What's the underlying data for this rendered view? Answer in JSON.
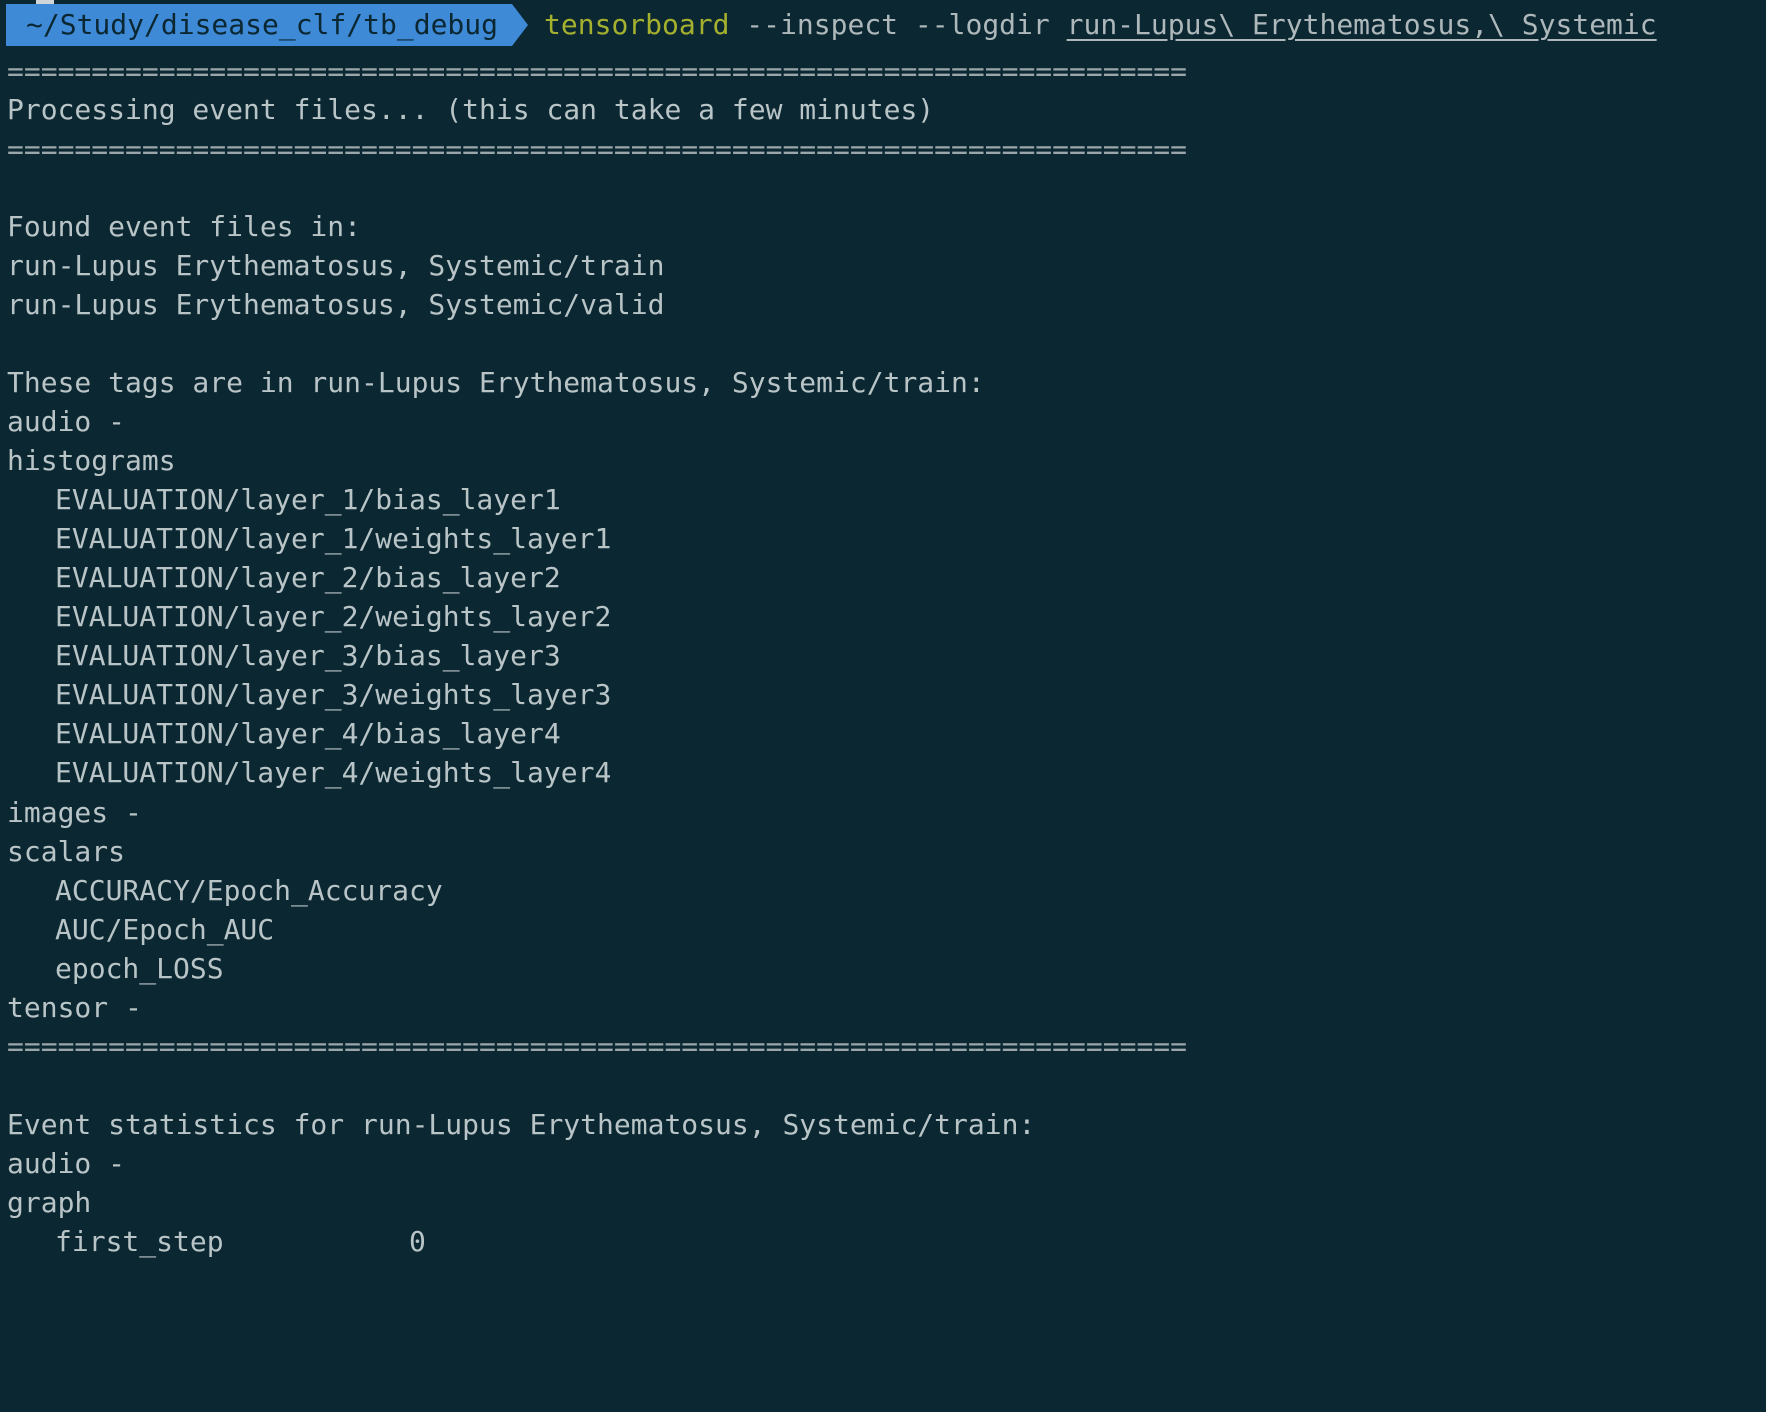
{
  "prompt": {
    "cwd": "~/Study/disease_clf/tb_debug",
    "command": "tensorboard",
    "args": " --inspect --logdir ",
    "path_arg": "run-Lupus\\ Erythematosus,\\ Systemic"
  },
  "lines": {
    "sep1": "======================================================================",
    "processing": "Processing event files... (this can take a few minutes)",
    "sep2": "======================================================================",
    "found": "Found event files in:",
    "run_train": "run-Lupus Erythematosus, Systemic/train",
    "run_valid": "run-Lupus Erythematosus, Systemic/valid",
    "tags_header": "These tags are in run-Lupus Erythematosus, Systemic/train:",
    "audio": "audio -",
    "histograms": "histograms",
    "hist_items": [
      "EVALUATION/layer_1/bias_layer1",
      "EVALUATION/layer_1/weights_layer1",
      "EVALUATION/layer_2/bias_layer2",
      "EVALUATION/layer_2/weights_layer2",
      "EVALUATION/layer_3/bias_layer3",
      "EVALUATION/layer_3/weights_layer3",
      "EVALUATION/layer_4/bias_layer4",
      "EVALUATION/layer_4/weights_layer4"
    ],
    "images": "images -",
    "scalars": "scalars",
    "scalar_items": [
      "ACCURACY/Epoch_Accuracy",
      "AUC/Epoch_AUC",
      "epoch_LOSS"
    ],
    "tensor": "tensor -",
    "sep3": "======================================================================",
    "stats_header": "Event statistics for run-Lupus Erythematosus, Systemic/train:",
    "stats_audio": "audio -",
    "graph": "graph",
    "first_step": "first_step           0"
  }
}
